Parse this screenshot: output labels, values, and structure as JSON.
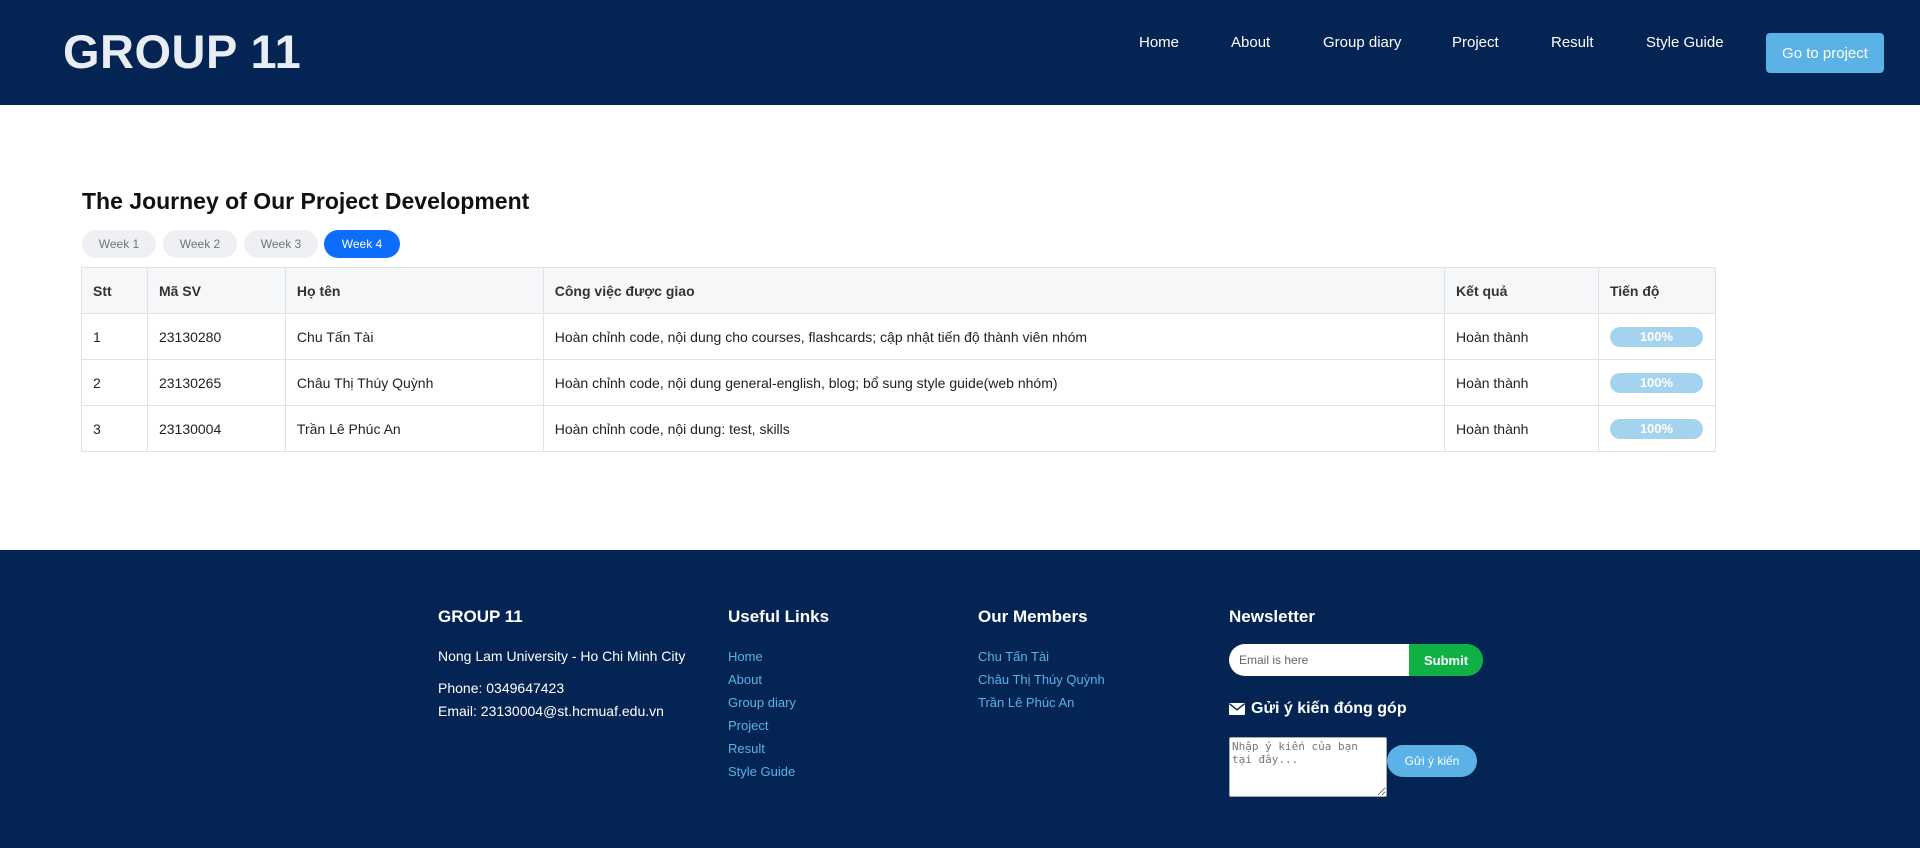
{
  "header": {
    "logo": "GROUP 11",
    "nav": [
      "Home",
      "About",
      "Group diary",
      "Project",
      "Result",
      "Style Guide"
    ],
    "cta_label": "Go to project"
  },
  "main": {
    "title": "The Journey of Our Project Development",
    "tabs": [
      "Week 1",
      "Week 2",
      "Week 3",
      "Week 4"
    ],
    "active_tab": "Week 4",
    "table": {
      "headers": [
        "Stt",
        "Mã SV",
        "Họ tên",
        "Công việc được giao",
        "Kết quả",
        "Tiến độ"
      ],
      "rows": [
        {
          "stt": "1",
          "id": "23130280",
          "name": "Chu Tấn Tài",
          "task": "Hoàn chỉnh code, nội dung cho courses, flashcards; cập nhật tiến độ thành viên nhóm",
          "result": "Hoàn thành",
          "progress": "100%",
          "progress_value": 100
        },
        {
          "stt": "2",
          "id": "23130265",
          "name": "Châu Thị Thúy Quỳnh",
          "task": "Hoàn chỉnh code, nội dung general-english, blog; bổ sung style guide(web nhóm)",
          "result": "Hoàn thành",
          "progress": "100%",
          "progress_value": 100
        },
        {
          "stt": "3",
          "id": "23130004",
          "name": "Trần Lê Phúc An",
          "task": "Hoàn chỉnh code, nội dung: test, skills",
          "result": "Hoàn thành",
          "progress": "100%",
          "progress_value": 100
        }
      ]
    }
  },
  "footer": {
    "about": {
      "heading": "GROUP 11",
      "university": "Nong Lam University - Ho Chi Minh City",
      "phone": "Phone: 0349647423",
      "email": "Email: 23130004@st.hcmuaf.edu.vn"
    },
    "links": {
      "heading": "Useful Links",
      "items": [
        "Home",
        "About",
        "Group diary",
        "Project",
        "Result",
        "Style Guide"
      ]
    },
    "members": {
      "heading": "Our Members",
      "items": [
        "Chu Tấn Tài",
        "Châu Thị Thúy Quỳnh",
        "Trần Lê Phúc An"
      ]
    },
    "newsletter": {
      "heading": "Newsletter",
      "placeholder": "Email is here",
      "submit_label": "Submit",
      "feedback_heading": "Gửi ý kiến đóng góp",
      "feedback_icon": "envelope-icon",
      "feedback_placeholder": "Nhập ý kiến của bạn tại đây...",
      "feedback_button": "Gửi ý kiến"
    }
  },
  "colors": {
    "navy": "#042453",
    "accent": "#5ab2e6",
    "tab_active": "#0d6efd",
    "submit": "#0fb145",
    "progress": "#a4d3ef"
  }
}
